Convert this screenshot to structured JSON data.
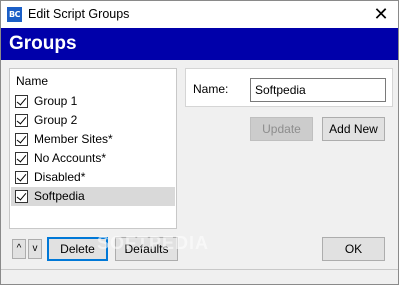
{
  "window": {
    "icon_text": "BC",
    "title": "Edit Script Groups",
    "close_glyph": "✕"
  },
  "banner": {
    "title": "Groups",
    "color": "#0000aa"
  },
  "list": {
    "header": "Name",
    "items": [
      {
        "label": "Group 1",
        "checked": true,
        "selected": false
      },
      {
        "label": "Group 2",
        "checked": true,
        "selected": false
      },
      {
        "label": "Member Sites*",
        "checked": true,
        "selected": false
      },
      {
        "label": "No Accounts*",
        "checked": true,
        "selected": false
      },
      {
        "label": "Disabled*",
        "checked": true,
        "selected": false
      },
      {
        "label": "Softpedia",
        "checked": true,
        "selected": true
      }
    ]
  },
  "detail": {
    "name_label": "Name:",
    "name_value": "Softpedia"
  },
  "buttons": {
    "update": "Update",
    "add_new": "Add New",
    "move_up": "^",
    "move_down": "v",
    "delete": "Delete",
    "defaults": "Defaults",
    "ok": "OK"
  },
  "watermark": "SOFTPEDIA"
}
